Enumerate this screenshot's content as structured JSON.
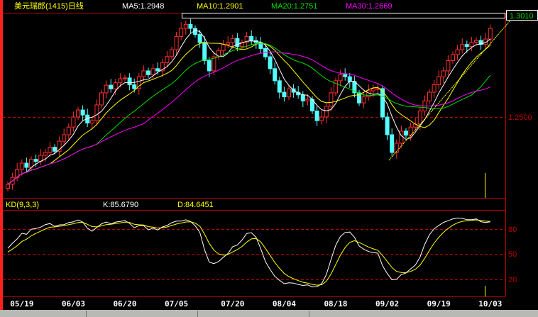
{
  "header": {
    "title": "美元瑞郎(1415)日线",
    "ma5": "MA5:1.2948",
    "ma10": "MA10:1.2901",
    "ma20": "MA20:1.2751",
    "ma30": "MA30:1.2669"
  },
  "kd_header": {
    "name": "KD(9,3,3)",
    "k": "K:85.6790",
    "d": "D:84.6451"
  },
  "colors": {
    "up": "#ff3030",
    "down": "#54ffff",
    "ma5": "#ffffff",
    "ma10": "#ffff00",
    "ma20": "#00e000",
    "ma30": "#ff00ff",
    "grid": "#c00000"
  },
  "chart_data": {
    "type": "candlestick",
    "title": "美元瑞郎(1415)日线",
    "price_axis": {
      "ticks": [
        "1.2500"
      ],
      "ylim": [
        1.21,
        1.305
      ],
      "highlight_label": "1.3010"
    },
    "kd_axis": {
      "ticks": [
        "80",
        "50",
        "20"
      ],
      "ylim": [
        0,
        100
      ]
    },
    "x_labels": [
      {
        "index": 3,
        "label": "05/19"
      },
      {
        "index": 14,
        "label": "06/03"
      },
      {
        "index": 25,
        "label": "06/20"
      },
      {
        "index": 36,
        "label": "07/05"
      },
      {
        "index": 48,
        "label": "07/20"
      },
      {
        "index": 59,
        "label": "08/04"
      },
      {
        "index": 70,
        "label": "08/18"
      },
      {
        "index": 81,
        "label": "09/02"
      },
      {
        "index": 92,
        "label": "09/19"
      },
      {
        "index": 103,
        "label": "10/03"
      }
    ],
    "close": [
      1.2166,
      1.22,
      1.224,
      1.2271,
      1.225,
      1.229,
      1.228,
      1.231,
      1.2324,
      1.235,
      1.233,
      1.238,
      1.2412,
      1.245,
      1.25,
      1.2535,
      1.251,
      1.247,
      1.2482,
      1.256,
      1.262,
      1.2658,
      1.264,
      1.267,
      1.269,
      1.2694,
      1.266,
      1.2641,
      1.27,
      1.2729,
      1.271,
      1.274,
      1.2729,
      1.277,
      1.28,
      1.2834,
      1.29,
      1.294,
      1.296,
      1.294,
      1.291,
      1.287,
      1.278,
      1.2729,
      1.2799,
      1.283,
      1.286,
      1.287,
      1.289,
      1.285,
      1.287,
      1.29,
      1.288,
      1.287,
      1.284,
      1.2799,
      1.274,
      1.268,
      1.2623,
      1.26,
      1.264,
      1.2623,
      1.261,
      1.258,
      1.2588,
      1.253,
      1.2482,
      1.25,
      1.2553,
      1.262,
      1.268,
      1.2711,
      1.27,
      1.2676,
      1.262,
      1.257,
      1.26,
      1.263,
      1.2641,
      1.2641,
      1.25,
      1.2412,
      1.2324,
      1.237,
      1.243,
      1.241,
      1.245,
      1.2465,
      1.253,
      1.258,
      1.2623,
      1.266,
      1.27,
      1.2729,
      1.278,
      1.281,
      1.2834,
      1.286,
      1.285,
      1.287,
      1.288,
      1.286,
      1.2887,
      1.294
    ]
  }
}
